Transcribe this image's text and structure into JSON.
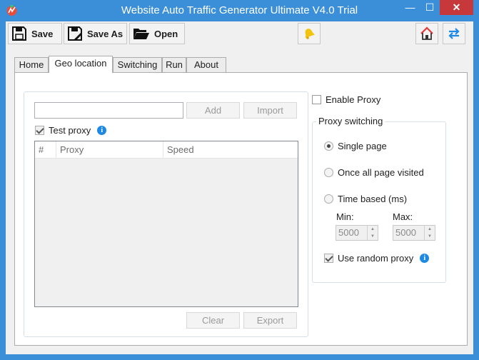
{
  "window": {
    "title": "Website Auto Traffic Generator Ultimate V4.0 Trial",
    "min": "—",
    "max": "☐",
    "close": "✕"
  },
  "toolbar": {
    "save_label": "Save",
    "save_as_label": "Save As",
    "open_label": "Open"
  },
  "tabs": [
    "Home",
    "Geo location",
    "Switching",
    "Run",
    "About"
  ],
  "active_tab": "Geo location",
  "proxy": {
    "input_value": "",
    "add_label": "Add",
    "import_label": "Import",
    "test_proxy_label": "Test proxy",
    "test_proxy_checked": true,
    "columns": [
      "#",
      "Proxy",
      "Speed"
    ],
    "rows": [],
    "clear_label": "Clear",
    "export_label": "Export"
  },
  "settings": {
    "enable_proxy_label": "Enable Proxy",
    "enable_proxy_checked": false,
    "group_title": "Proxy switching",
    "options": [
      "Single page",
      "Once all page visited",
      "Time based (ms)"
    ],
    "selected_option": "Single page",
    "min_label": "Min:",
    "max_label": "Max:",
    "min_value": "5000",
    "max_value": "5000",
    "random_proxy_label": "Use random proxy",
    "random_proxy_checked": true
  },
  "colors": {
    "title_bar": "#3b8fd9",
    "close": "#c7383b",
    "info": "#1e88e5"
  }
}
